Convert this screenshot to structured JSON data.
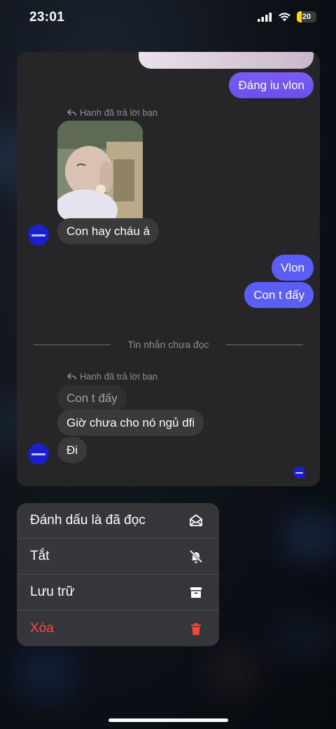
{
  "status_bar": {
    "time": "23:01",
    "battery_level": "20",
    "battery_color": "#ffd60a"
  },
  "chat": {
    "messages": [
      {
        "id": "m1",
        "text": "Đáng iu vlon",
        "direction": "outgoing"
      },
      {
        "id": "m2",
        "reply_note": "Hanh đã trả lời bạn",
        "type": "photo"
      },
      {
        "id": "m3",
        "text": "Con hay cháu á",
        "direction": "incoming"
      },
      {
        "id": "m4",
        "text": "Vlon",
        "direction": "outgoing"
      },
      {
        "id": "m5",
        "text": "Con t đấy",
        "direction": "outgoing"
      },
      {
        "id": "m6",
        "reply_note": "Hanh đã trả lời bạn",
        "quoted": "Con t đấy"
      },
      {
        "id": "m7",
        "text": "Giờ chưa cho nó ngủ dfi",
        "direction": "incoming"
      },
      {
        "id": "m8",
        "text": "Đi",
        "direction": "incoming"
      }
    ],
    "unread_divider": "Tin nhắn chưa đọc",
    "accent_outgoing": "#6b4ff0",
    "accent_outgoing_blue": "#5b5ef5"
  },
  "context_menu": {
    "items": [
      {
        "label": "Đánh dấu là đã đọc",
        "icon": "envelope-open-icon"
      },
      {
        "label": "Tắt",
        "icon": "bell-slash-icon"
      },
      {
        "label": "Lưu trữ",
        "icon": "archive-box-icon"
      },
      {
        "label": "Xóa",
        "icon": "trash-icon",
        "color": "#ff453a"
      }
    ]
  }
}
